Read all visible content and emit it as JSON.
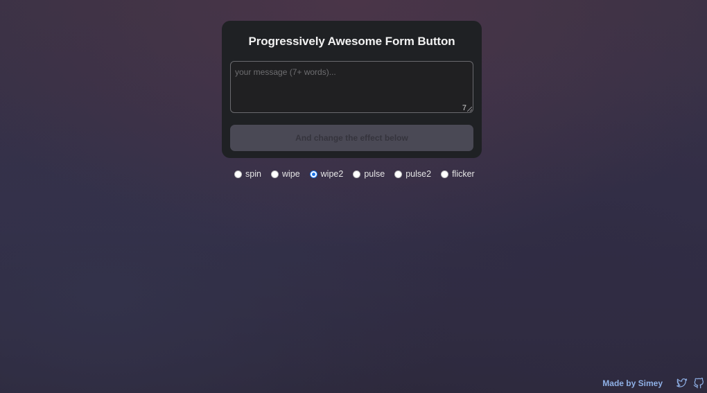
{
  "form": {
    "title": "Progressively Awesome Form Button",
    "message_placeholder": "your message (7+ words)...",
    "message_value": "",
    "word_count_remaining": "7",
    "submit_label": "And change the effect below"
  },
  "effects": {
    "options": [
      "spin",
      "wipe",
      "wipe2",
      "pulse",
      "pulse2",
      "flicker"
    ],
    "selected": "wipe2"
  },
  "footer": {
    "made_by": "Made by Simey",
    "icons": [
      "twitter-icon",
      "github-icon"
    ]
  },
  "colors": {
    "card_bg": "#1f2124",
    "button_disabled_bg": "#4a4955",
    "link": "#8fb0e6",
    "radio_accent": "#1a73e8"
  }
}
